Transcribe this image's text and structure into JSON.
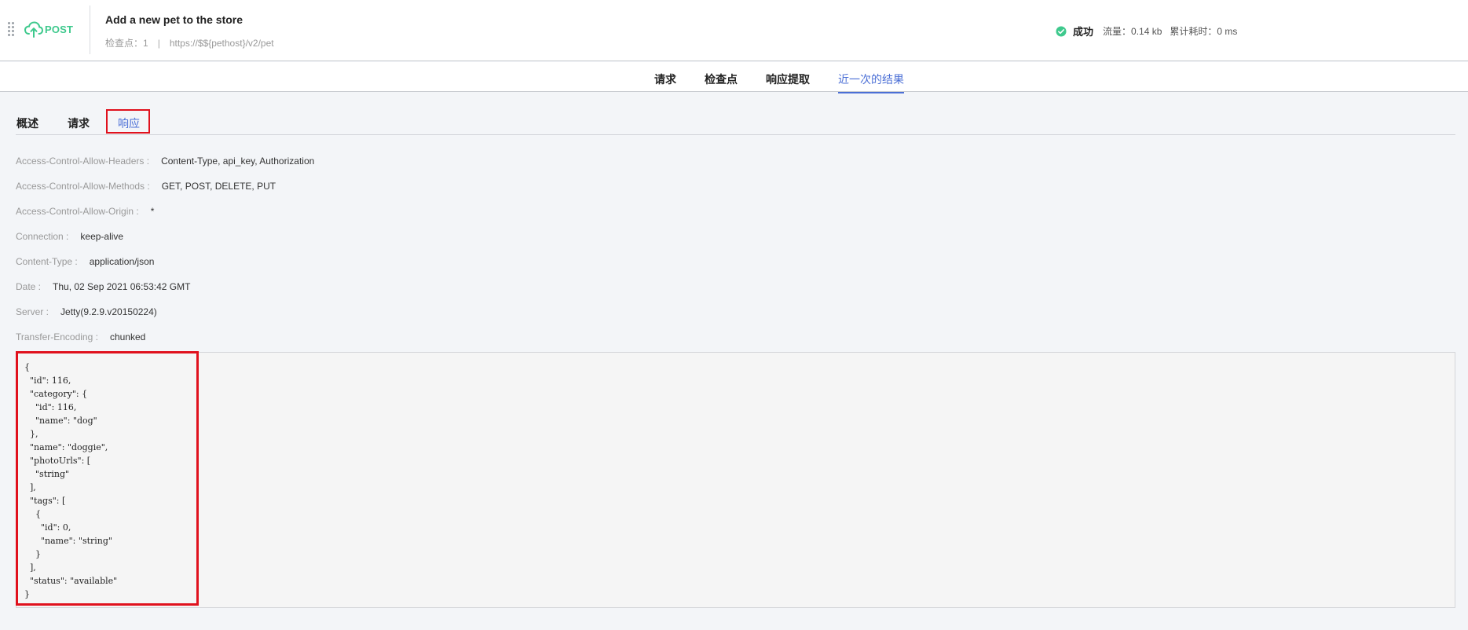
{
  "header": {
    "method": "POST",
    "title": "Add a new pet to the store",
    "checkpoint_label": "检查点：",
    "checkpoint_count": "1",
    "separator": "|",
    "url": "https://$${pethost}/v2/pet",
    "status_text": "成功",
    "traffic_label": "流量：",
    "traffic_value": "0.14 kb",
    "time_label": "累计耗时：",
    "time_value": "0 ms",
    "colors": {
      "method": "#3ec98d",
      "success": "#3ec98d"
    }
  },
  "top_tabs": [
    {
      "label": "请求"
    },
    {
      "label": "检查点"
    },
    {
      "label": "响应提取"
    },
    {
      "label": "近一次的结果",
      "active": true
    }
  ],
  "sub_tabs": [
    {
      "label": "概述"
    },
    {
      "label": "请求"
    },
    {
      "label": "响应",
      "active": true
    }
  ],
  "response_headers": [
    {
      "key": "Access-Control-Allow-Headers :",
      "value": "Content-Type, api_key, Authorization"
    },
    {
      "key": "Access-Control-Allow-Methods :",
      "value": "GET, POST, DELETE, PUT"
    },
    {
      "key": "Access-Control-Allow-Origin :",
      "value": "*"
    },
    {
      "key": "Connection :",
      "value": "keep-alive"
    },
    {
      "key": "Content-Type :",
      "value": "application/json"
    },
    {
      "key": "Date :",
      "value": "Thu, 02 Sep 2021 06:53:42 GMT"
    },
    {
      "key": "Server :",
      "value": "Jetty(9.2.9.v20150224)"
    },
    {
      "key": "Transfer-Encoding :",
      "value": "chunked"
    }
  ],
  "response_body": "{\n  \"id\": 116,\n  \"category\": {\n    \"id\": 116,\n    \"name\": \"dog\"\n  },\n  \"name\": \"doggie\",\n  \"photoUrls\": [\n    \"string\"\n  ],\n  \"tags\": [\n    {\n      \"id\": 0,\n      \"name\": \"string\"\n    }\n  ],\n  \"status\": \"available\"\n}",
  "accent_color": "#4b6fd6",
  "highlight_color": "#e0111d"
}
